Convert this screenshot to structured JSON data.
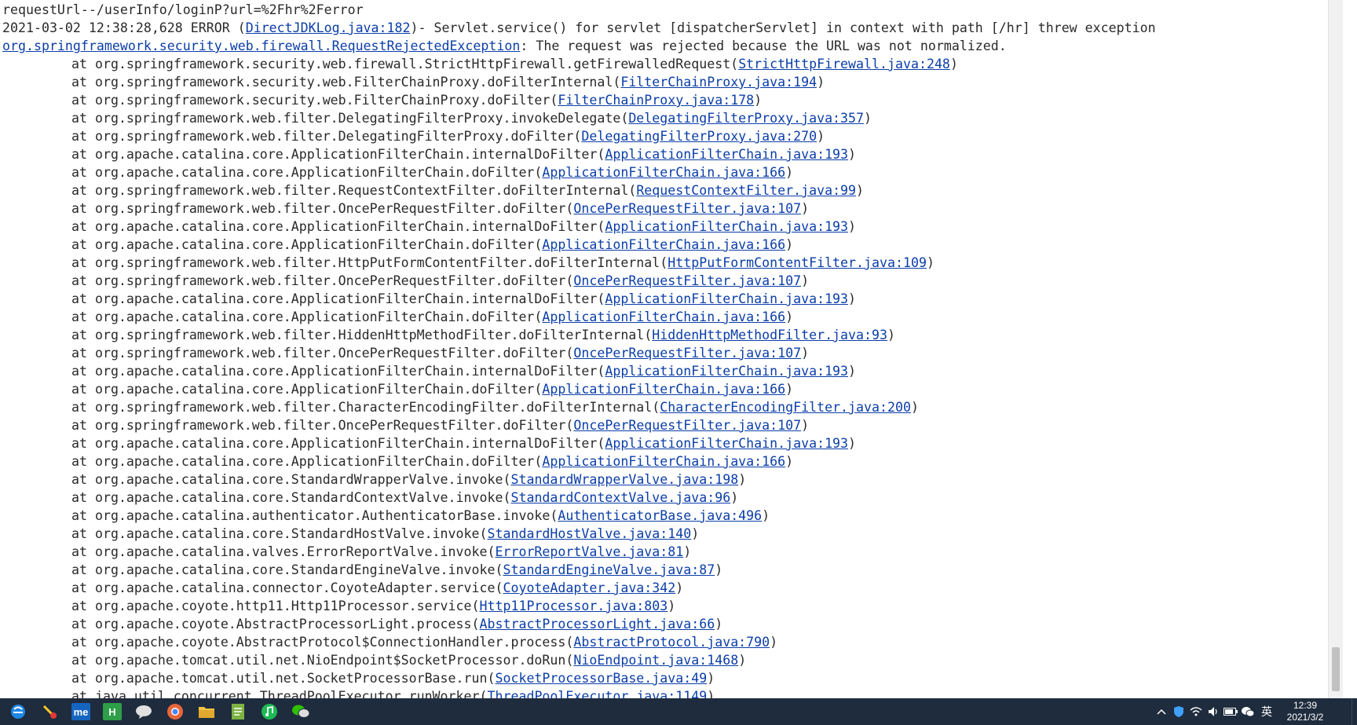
{
  "console": {
    "lines": [
      {
        "indent": false,
        "parts": [
          {
            "t": "requestUrl--/userInfo/loginP?url=%2Fhr%2Ferror"
          }
        ]
      },
      {
        "indent": false,
        "parts": [
          {
            "t": "2021-03-02 12:38:28,628 ERROR ("
          },
          {
            "t": "DirectJDKLog.java:182",
            "link": true
          },
          {
            "t": ")- Servlet.service() for servlet [dispatcherServlet] in context with path [/hr] threw exception"
          }
        ]
      },
      {
        "indent": false,
        "parts": [
          {
            "t": "org.springframework.security.web.firewall.RequestRejectedException",
            "link": true
          },
          {
            "t": ": The request was rejected because the URL was not normalized."
          }
        ]
      },
      {
        "indent": true,
        "parts": [
          {
            "t": "at org.springframework.security.web.firewall.StrictHttpFirewall.getFirewalledRequest("
          },
          {
            "t": "StrictHttpFirewall.java:248",
            "link": true
          },
          {
            "t": ")"
          }
        ]
      },
      {
        "indent": true,
        "parts": [
          {
            "t": "at org.springframework.security.web.FilterChainProxy.doFilterInternal("
          },
          {
            "t": "FilterChainProxy.java:194",
            "link": true
          },
          {
            "t": ")"
          }
        ]
      },
      {
        "indent": true,
        "parts": [
          {
            "t": "at org.springframework.security.web.FilterChainProxy.doFilter("
          },
          {
            "t": "FilterChainProxy.java:178",
            "link": true
          },
          {
            "t": ")"
          }
        ]
      },
      {
        "indent": true,
        "parts": [
          {
            "t": "at org.springframework.web.filter.DelegatingFilterProxy.invokeDelegate("
          },
          {
            "t": "DelegatingFilterProxy.java:357",
            "link": true
          },
          {
            "t": ")"
          }
        ]
      },
      {
        "indent": true,
        "parts": [
          {
            "t": "at org.springframework.web.filter.DelegatingFilterProxy.doFilter("
          },
          {
            "t": "DelegatingFilterProxy.java:270",
            "link": true
          },
          {
            "t": ")"
          }
        ]
      },
      {
        "indent": true,
        "parts": [
          {
            "t": "at org.apache.catalina.core.ApplicationFilterChain.internalDoFilter("
          },
          {
            "t": "ApplicationFilterChain.java:193",
            "link": true
          },
          {
            "t": ")"
          }
        ]
      },
      {
        "indent": true,
        "parts": [
          {
            "t": "at org.apache.catalina.core.ApplicationFilterChain.doFilter("
          },
          {
            "t": "ApplicationFilterChain.java:166",
            "link": true
          },
          {
            "t": ")"
          }
        ]
      },
      {
        "indent": true,
        "parts": [
          {
            "t": "at org.springframework.web.filter.RequestContextFilter.doFilterInternal("
          },
          {
            "t": "RequestContextFilter.java:99",
            "link": true
          },
          {
            "t": ")"
          }
        ]
      },
      {
        "indent": true,
        "parts": [
          {
            "t": "at org.springframework.web.filter.OncePerRequestFilter.doFilter("
          },
          {
            "t": "OncePerRequestFilter.java:107",
            "link": true
          },
          {
            "t": ")"
          }
        ]
      },
      {
        "indent": true,
        "parts": [
          {
            "t": "at org.apache.catalina.core.ApplicationFilterChain.internalDoFilter("
          },
          {
            "t": "ApplicationFilterChain.java:193",
            "link": true
          },
          {
            "t": ")"
          }
        ]
      },
      {
        "indent": true,
        "parts": [
          {
            "t": "at org.apache.catalina.core.ApplicationFilterChain.doFilter("
          },
          {
            "t": "ApplicationFilterChain.java:166",
            "link": true
          },
          {
            "t": ")"
          }
        ]
      },
      {
        "indent": true,
        "parts": [
          {
            "t": "at org.springframework.web.filter.HttpPutFormContentFilter.doFilterInternal("
          },
          {
            "t": "HttpPutFormContentFilter.java:109",
            "link": true
          },
          {
            "t": ")"
          }
        ]
      },
      {
        "indent": true,
        "parts": [
          {
            "t": "at org.springframework.web.filter.OncePerRequestFilter.doFilter("
          },
          {
            "t": "OncePerRequestFilter.java:107",
            "link": true
          },
          {
            "t": ")"
          }
        ]
      },
      {
        "indent": true,
        "parts": [
          {
            "t": "at org.apache.catalina.core.ApplicationFilterChain.internalDoFilter("
          },
          {
            "t": "ApplicationFilterChain.java:193",
            "link": true
          },
          {
            "t": ")"
          }
        ]
      },
      {
        "indent": true,
        "parts": [
          {
            "t": "at org.apache.catalina.core.ApplicationFilterChain.doFilter("
          },
          {
            "t": "ApplicationFilterChain.java:166",
            "link": true
          },
          {
            "t": ")"
          }
        ]
      },
      {
        "indent": true,
        "parts": [
          {
            "t": "at org.springframework.web.filter.HiddenHttpMethodFilter.doFilterInternal("
          },
          {
            "t": "HiddenHttpMethodFilter.java:93",
            "link": true
          },
          {
            "t": ")"
          }
        ]
      },
      {
        "indent": true,
        "parts": [
          {
            "t": "at org.springframework.web.filter.OncePerRequestFilter.doFilter("
          },
          {
            "t": "OncePerRequestFilter.java:107",
            "link": true
          },
          {
            "t": ")"
          }
        ]
      },
      {
        "indent": true,
        "parts": [
          {
            "t": "at org.apache.catalina.core.ApplicationFilterChain.internalDoFilter("
          },
          {
            "t": "ApplicationFilterChain.java:193",
            "link": true
          },
          {
            "t": ")"
          }
        ]
      },
      {
        "indent": true,
        "parts": [
          {
            "t": "at org.apache.catalina.core.ApplicationFilterChain.doFilter("
          },
          {
            "t": "ApplicationFilterChain.java:166",
            "link": true
          },
          {
            "t": ")"
          }
        ]
      },
      {
        "indent": true,
        "parts": [
          {
            "t": "at org.springframework.web.filter.CharacterEncodingFilter.doFilterInternal("
          },
          {
            "t": "CharacterEncodingFilter.java:200",
            "link": true
          },
          {
            "t": ")"
          }
        ]
      },
      {
        "indent": true,
        "parts": [
          {
            "t": "at org.springframework.web.filter.OncePerRequestFilter.doFilter("
          },
          {
            "t": "OncePerRequestFilter.java:107",
            "link": true
          },
          {
            "t": ")"
          }
        ]
      },
      {
        "indent": true,
        "parts": [
          {
            "t": "at org.apache.catalina.core.ApplicationFilterChain.internalDoFilter("
          },
          {
            "t": "ApplicationFilterChain.java:193",
            "link": true
          },
          {
            "t": ")"
          }
        ]
      },
      {
        "indent": true,
        "parts": [
          {
            "t": "at org.apache.catalina.core.ApplicationFilterChain.doFilter("
          },
          {
            "t": "ApplicationFilterChain.java:166",
            "link": true
          },
          {
            "t": ")"
          }
        ]
      },
      {
        "indent": true,
        "parts": [
          {
            "t": "at org.apache.catalina.core.StandardWrapperValve.invoke("
          },
          {
            "t": "StandardWrapperValve.java:198",
            "link": true
          },
          {
            "t": ")"
          }
        ]
      },
      {
        "indent": true,
        "parts": [
          {
            "t": "at org.apache.catalina.core.StandardContextValve.invoke("
          },
          {
            "t": "StandardContextValve.java:96",
            "link": true
          },
          {
            "t": ")"
          }
        ]
      },
      {
        "indent": true,
        "parts": [
          {
            "t": "at org.apache.catalina.authenticator.AuthenticatorBase.invoke("
          },
          {
            "t": "AuthenticatorBase.java:496",
            "link": true
          },
          {
            "t": ")"
          }
        ]
      },
      {
        "indent": true,
        "parts": [
          {
            "t": "at org.apache.catalina.core.StandardHostValve.invoke("
          },
          {
            "t": "StandardHostValve.java:140",
            "link": true
          },
          {
            "t": ")"
          }
        ]
      },
      {
        "indent": true,
        "parts": [
          {
            "t": "at org.apache.catalina.valves.ErrorReportValve.invoke("
          },
          {
            "t": "ErrorReportValve.java:81",
            "link": true
          },
          {
            "t": ")"
          }
        ]
      },
      {
        "indent": true,
        "parts": [
          {
            "t": "at org.apache.catalina.core.StandardEngineValve.invoke("
          },
          {
            "t": "StandardEngineValve.java:87",
            "link": true
          },
          {
            "t": ")"
          }
        ]
      },
      {
        "indent": true,
        "parts": [
          {
            "t": "at org.apache.catalina.connector.CoyoteAdapter.service("
          },
          {
            "t": "CoyoteAdapter.java:342",
            "link": true
          },
          {
            "t": ")"
          }
        ]
      },
      {
        "indent": true,
        "parts": [
          {
            "t": "at org.apache.coyote.http11.Http11Processor.service("
          },
          {
            "t": "Http11Processor.java:803",
            "link": true
          },
          {
            "t": ")"
          }
        ]
      },
      {
        "indent": true,
        "parts": [
          {
            "t": "at org.apache.coyote.AbstractProcessorLight.process("
          },
          {
            "t": "AbstractProcessorLight.java:66",
            "link": true
          },
          {
            "t": ")"
          }
        ]
      },
      {
        "indent": true,
        "parts": [
          {
            "t": "at org.apache.coyote.AbstractProtocol$ConnectionHandler.process("
          },
          {
            "t": "AbstractProtocol.java:790",
            "link": true
          },
          {
            "t": ")"
          }
        ]
      },
      {
        "indent": true,
        "parts": [
          {
            "t": "at org.apache.tomcat.util.net.NioEndpoint$SocketProcessor.doRun("
          },
          {
            "t": "NioEndpoint.java:1468",
            "link": true
          },
          {
            "t": ")"
          }
        ]
      },
      {
        "indent": true,
        "parts": [
          {
            "t": "at org.apache.tomcat.util.net.SocketProcessorBase.run("
          },
          {
            "t": "SocketProcessorBase.java:49",
            "link": true
          },
          {
            "t": ")"
          }
        ]
      },
      {
        "indent": true,
        "parts": [
          {
            "t": "at java.util.concurrent.ThreadPoolExecutor.runWorker("
          },
          {
            "t": "ThreadPoolExecutor.java:1149",
            "link": true
          },
          {
            "t": ")"
          }
        ]
      }
    ]
  },
  "taskbar": {
    "apps": [
      {
        "name": "ie-icon",
        "glyph": "",
        "color": "#1e88e5"
      },
      {
        "name": "paint-icon",
        "glyph": "",
        "color": "#e53935"
      },
      {
        "name": "me-app-icon",
        "glyph": "me",
        "color": "#1565c0"
      },
      {
        "name": "hbuilder-icon",
        "glyph": "H",
        "color": "#2e9e48"
      },
      {
        "name": "chat-bubble-icon",
        "glyph": "",
        "color": "#e0e0e0"
      },
      {
        "name": "chrome-icon",
        "glyph": "",
        "color": "#e8663b"
      },
      {
        "name": "folder-icon",
        "glyph": "",
        "color": "#f5c342"
      },
      {
        "name": "notepad-icon",
        "glyph": "",
        "color": "#7cb342"
      },
      {
        "name": "music-icon",
        "glyph": "",
        "color": "#1db954"
      },
      {
        "name": "wechat-icon",
        "glyph": "",
        "color": "#2dc100"
      }
    ],
    "tray": {
      "ime": "英",
      "time": "12:39",
      "date": "2021/3/2"
    }
  },
  "colors": {
    "link": "#0b3ea8",
    "text": "#2a2a2a",
    "taskbar": "#1f2c3d"
  }
}
